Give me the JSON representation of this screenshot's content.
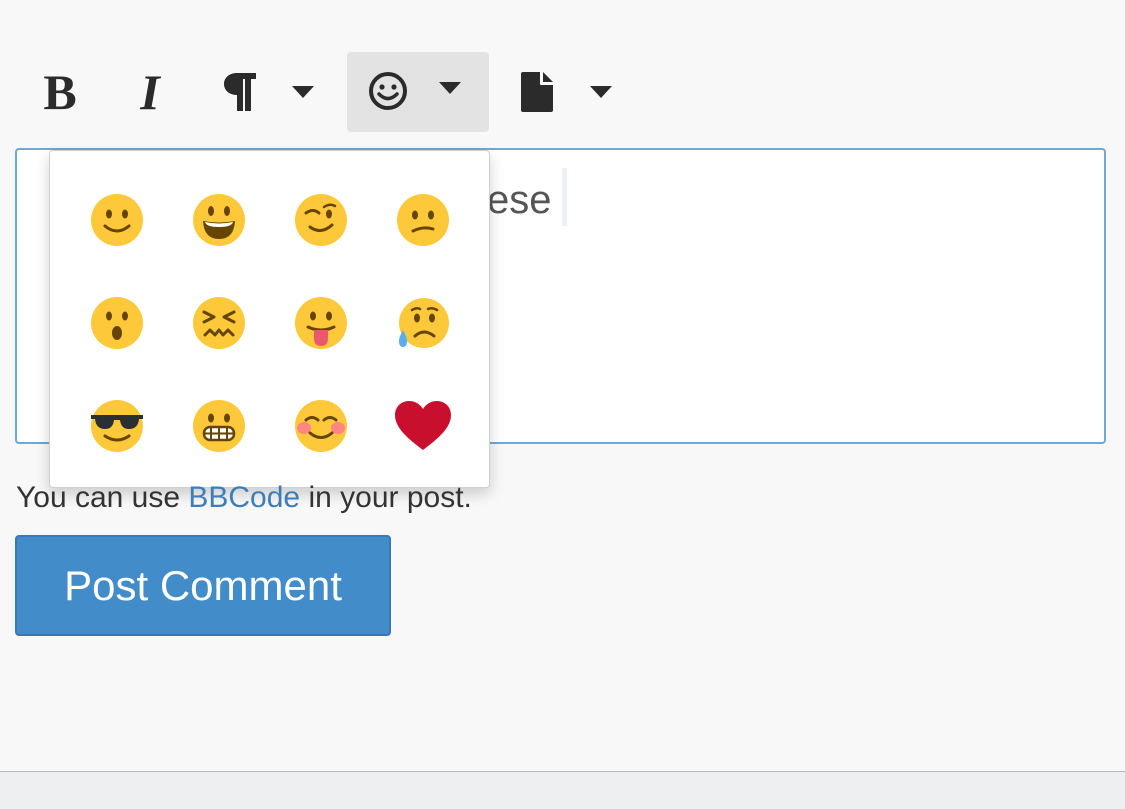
{
  "toolbar": {
    "bold_label": "B",
    "italic_label": "I",
    "buttons": [
      "bold-icon",
      "italic-icon",
      "paragraph-icon",
      "smiley-icon",
      "file-icon"
    ]
  },
  "editor": {
    "visible_text": "ese"
  },
  "emoji_picker": {
    "emojis": [
      "slightly-smiling",
      "grinning",
      "winking",
      "confused",
      "surprised",
      "confounded",
      "tongue-out",
      "sad-sweat",
      "sunglasses",
      "grimacing",
      "blushing",
      "red-heart"
    ]
  },
  "help": {
    "prefix": "You can use ",
    "link": "BBCode",
    "suffix": " in your post."
  },
  "submit": {
    "label": "Post Comment"
  },
  "colors": {
    "accent": "#438cca",
    "link": "#3c7eb8",
    "emoji_yellow": "#fdc93a",
    "heart_red": "#c8102e"
  }
}
